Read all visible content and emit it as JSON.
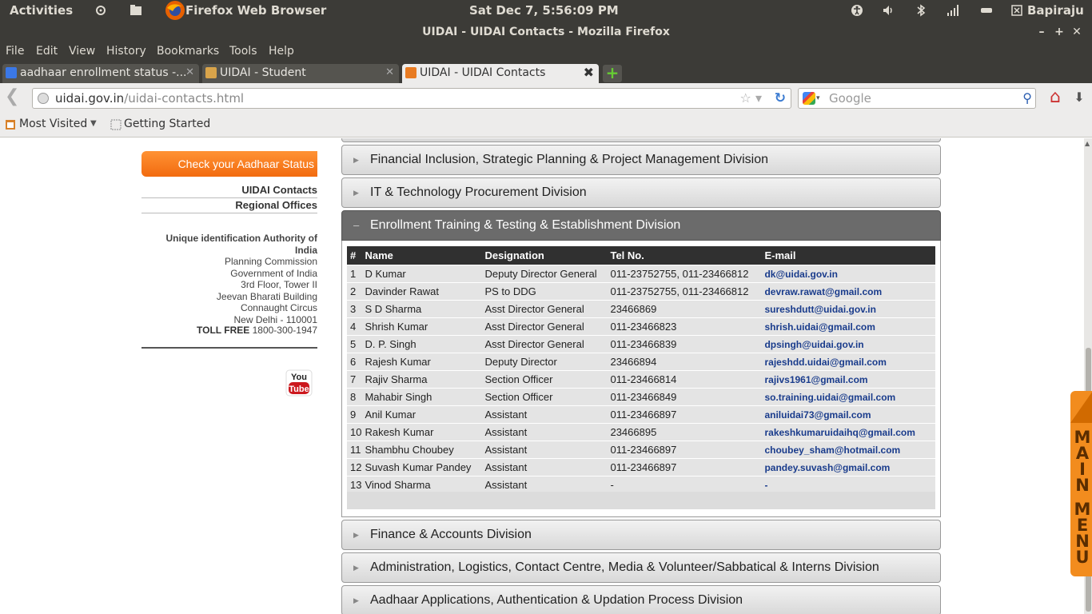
{
  "panel": {
    "activities": "Activities",
    "app": "Firefox Web Browser",
    "clock": "Sat Dec  7,  5:56:09 PM",
    "user": "Bapiraju"
  },
  "window": {
    "title": "UIDAI - UIDAI Contacts - Mozilla Firefox"
  },
  "menu": [
    "File",
    "Edit",
    "View",
    "History",
    "Bookmarks",
    "Tools",
    "Help"
  ],
  "tabs": [
    {
      "label": "aadhaar enrollment status -..."
    },
    {
      "label": "UIDAI - Student"
    },
    {
      "label": "UIDAI - UIDAI Contacts"
    }
  ],
  "nav": {
    "url_host": "uidai.gov.in",
    "url_path": "/uidai-contacts.html",
    "search_placeholder": "Google"
  },
  "bookmarks": {
    "most_visited": "Most Visited",
    "getting_started": "Getting Started"
  },
  "sidebar": {
    "check_status": "Check your Aadhaar Status",
    "links": [
      "UIDAI Contacts",
      "Regional Offices"
    ],
    "address": {
      "org": "Unique identification Authority of India",
      "lines": [
        "Planning Commission",
        "Government of India",
        "3rd Floor, Tower II",
        "Jeevan Bharati Building",
        "Connaught Circus",
        "New Delhi - 110001"
      ]
    },
    "toll_label": "TOLL FREE",
    "toll_number": "1800-300-1947",
    "youtube_text": "You Tube"
  },
  "divisions": {
    "d1": "Financial Inclusion, Strategic Planning & Project Management Division",
    "d2": "IT & Technology Procurement Division",
    "d3": "Enrollment Training & Testing & Establishment Division",
    "d4": "Finance & Accounts Division",
    "d5": "Administration, Logistics, Contact Centre, Media & Volunteer/Sabbatical & Interns Division",
    "d6": "Aadhaar Applications, Authentication & Updation Process Division"
  },
  "table": {
    "headers": [
      "#",
      "Name",
      "Designation",
      "Tel No.",
      "E-mail"
    ],
    "rows": [
      [
        "1",
        "D Kumar",
        "Deputy Director General",
        "011-23752755, 011-23466812",
        "dk@uidai.gov.in"
      ],
      [
        "2",
        "Davinder Rawat",
        "PS to DDG",
        "011-23752755, 011-23466812",
        "devraw.rawat@gmail.com"
      ],
      [
        "3",
        "S D Sharma",
        "Asst Director General",
        "23466869",
        "sureshdutt@uidai.gov.in"
      ],
      [
        "4",
        "Shrish Kumar",
        "Asst Director General",
        "011-23466823",
        "shrish.uidai@gmail.com"
      ],
      [
        "5",
        "D. P. Singh",
        "Asst Director General",
        "011-23466839",
        "dpsingh@uidai.gov.in"
      ],
      [
        "6",
        "Rajesh Kumar",
        "Deputy Director",
        "23466894",
        "rajeshdd.uidai@gmail.com"
      ],
      [
        "7",
        "Rajiv Sharma",
        "Section Officer",
        "011-23466814",
        "rajivs1961@gmail.com"
      ],
      [
        "8",
        "Mahabir Singh",
        "Section Officer",
        "011-23466849",
        "so.training.uidai@gmail.com"
      ],
      [
        "9",
        "Anil Kumar",
        "Assistant",
        "011-23466897",
        "aniluidai73@gmail.com"
      ],
      [
        "10",
        "Rakesh Kumar",
        "Assistant",
        "23466895",
        "rakeshkumaruidaihq@gmail.com"
      ],
      [
        "11",
        "Shambhu Choubey",
        "Assistant",
        "011-23466897",
        "choubey_sham@hotmail.com"
      ],
      [
        "12",
        "Suvash Kumar Pandey",
        "Assistant",
        "011-23466897",
        "pandey.suvash@gmail.com"
      ],
      [
        "13",
        "Vinod Sharma",
        "Assistant",
        "-",
        "-"
      ]
    ]
  },
  "main_menu_letters": [
    "M",
    "A",
    "I",
    "N",
    "M",
    "E",
    "N",
    "U"
  ],
  "colors": {
    "accent_orange": "#f26b0f",
    "header_dark": "#303030",
    "email_blue": "#1a3c8c"
  }
}
